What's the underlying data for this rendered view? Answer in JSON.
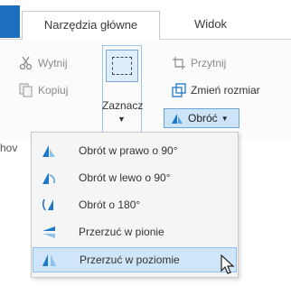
{
  "tabs": {
    "home": "Narzędzia główne",
    "view": "Widok"
  },
  "clipboard": {
    "cut": "Wytnij",
    "copy": "Kopiuj"
  },
  "image": {
    "select": "Zaznacz",
    "crop": "Przytnij",
    "resize": "Zmień rozmiar",
    "rotate": "Obróć"
  },
  "group": {
    "label_fragment": "hov"
  },
  "rotate_menu": {
    "items": [
      {
        "label": "Obrót w prawo o 90°",
        "icon": "rotate-right-icon"
      },
      {
        "label": "Obrót w lewo o 90°",
        "icon": "rotate-left-icon"
      },
      {
        "label": "Obrót o 180°",
        "icon": "rotate-180-icon"
      },
      {
        "label": "Przerzuć w pionie",
        "icon": "flip-vertical-icon"
      },
      {
        "label": "Przerzuć w poziomie",
        "icon": "flip-horizontal-icon"
      }
    ]
  },
  "colors": {
    "accent": "#1f6fbf",
    "highlight": "#cfe5f9",
    "icon_blue": "#1e78c8"
  }
}
